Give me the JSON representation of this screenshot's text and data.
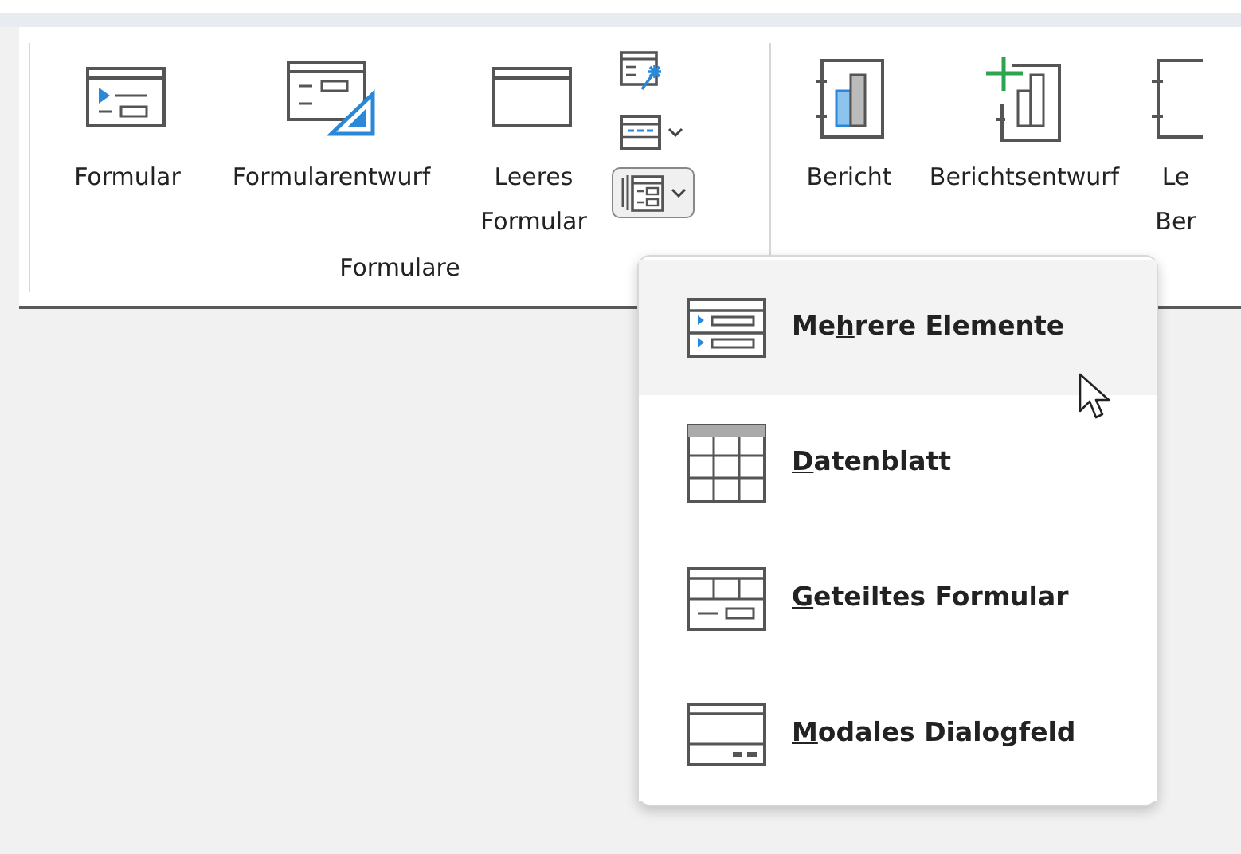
{
  "ribbon": {
    "groups": [
      {
        "label": "Formulare",
        "large_buttons": [
          {
            "kind": "form",
            "label": [
              "Formular"
            ]
          },
          {
            "kind": "form_design",
            "label": [
              "Formularentwurf"
            ]
          },
          {
            "kind": "blank_form",
            "label": [
              "Leeres",
              "Formular"
            ]
          }
        ],
        "small_buttons": [
          {
            "kind": "wizard",
            "has_menu": false,
            "pressed": false
          },
          {
            "kind": "navigation",
            "has_menu": true,
            "pressed": false
          },
          {
            "kind": "more_forms",
            "has_menu": true,
            "pressed": true
          }
        ]
      },
      {
        "large_buttons": [
          {
            "kind": "report",
            "label": [
              "Bericht"
            ]
          },
          {
            "kind": "report_design",
            "label": [
              "Berichtsentwurf"
            ]
          },
          {
            "kind": "blank_report",
            "label": [
              "Le",
              "Ber"
            ]
          }
        ]
      }
    ]
  },
  "dropdown_menu": {
    "items": [
      {
        "kind": "multiple_items",
        "label_before": "Me",
        "access_key": "h",
        "label_after": "rere Elemente",
        "hovered": true
      },
      {
        "kind": "datasheet",
        "access_key": "D",
        "label_after": "atenblatt",
        "hovered": false
      },
      {
        "kind": "split_form",
        "access_key": "G",
        "label_after": "eteiltes Formular",
        "hovered": false
      },
      {
        "kind": "modal_dialog",
        "access_key": "M",
        "label_after": "odales Dialogfeld",
        "hovered": false
      }
    ]
  }
}
